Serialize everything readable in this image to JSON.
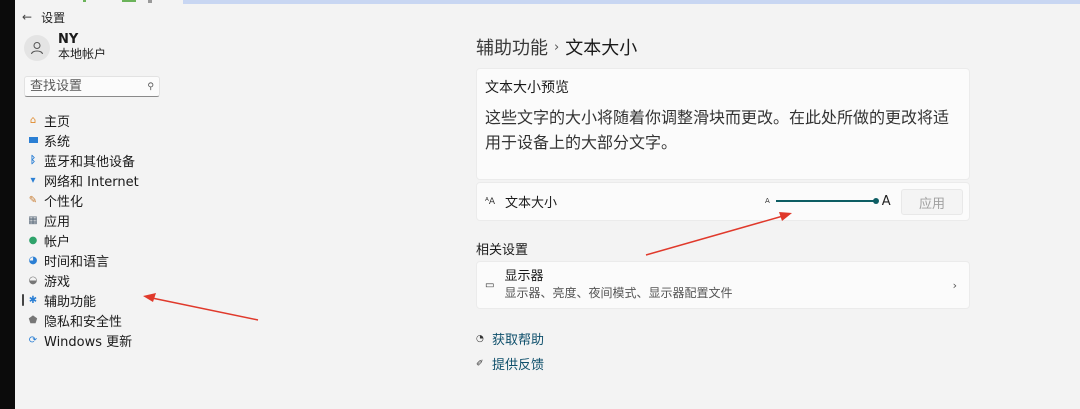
{
  "window": {
    "title": "设置",
    "back_glyph": "←"
  },
  "user": {
    "name": "NY",
    "account_type": "本地帐户"
  },
  "search": {
    "placeholder": "查找设置",
    "value": ""
  },
  "nav": {
    "items": [
      {
        "label": "主页",
        "icon": "home-icon"
      },
      {
        "label": "系统",
        "icon": "system-icon"
      },
      {
        "label": "蓝牙和其他设备",
        "icon": "bluetooth-icon"
      },
      {
        "label": "网络和 Internet",
        "icon": "wifi-icon"
      },
      {
        "label": "个性化",
        "icon": "brush-icon"
      },
      {
        "label": "应用",
        "icon": "apps-icon"
      },
      {
        "label": "帐户",
        "icon": "account-icon"
      },
      {
        "label": "时间和语言",
        "icon": "clock-globe-icon"
      },
      {
        "label": "游戏",
        "icon": "gamepad-icon"
      },
      {
        "label": "辅助功能",
        "icon": "accessibility-icon",
        "active": true
      },
      {
        "label": "隐私和安全性",
        "icon": "shield-icon"
      },
      {
        "label": "Windows 更新",
        "icon": "update-icon"
      }
    ]
  },
  "breadcrumb": {
    "parent": "辅助功能",
    "separator": "›",
    "current": "文本大小"
  },
  "preview": {
    "title": "文本大小预览",
    "text": "这些文字的大小将随着你调整滑块而更改。在此处所做的更改将适用于设备上的大部分文字。"
  },
  "text_size": {
    "label": "文本大小",
    "aa_glyph": "ᴬA",
    "slider_min_label": "A",
    "slider_max_label": "A",
    "slider_value_fraction": 1.0,
    "apply_label": "应用"
  },
  "related": {
    "heading": "相关设置",
    "display": {
      "title": "显示器",
      "subtitle": "显示器、亮度、夜间模式、显示器配置文件"
    }
  },
  "links": {
    "help": "获取帮助",
    "feedback": "提供反馈"
  },
  "colors": {
    "accent": "#0d5d63",
    "annotation_arrow": "#e0392b"
  }
}
